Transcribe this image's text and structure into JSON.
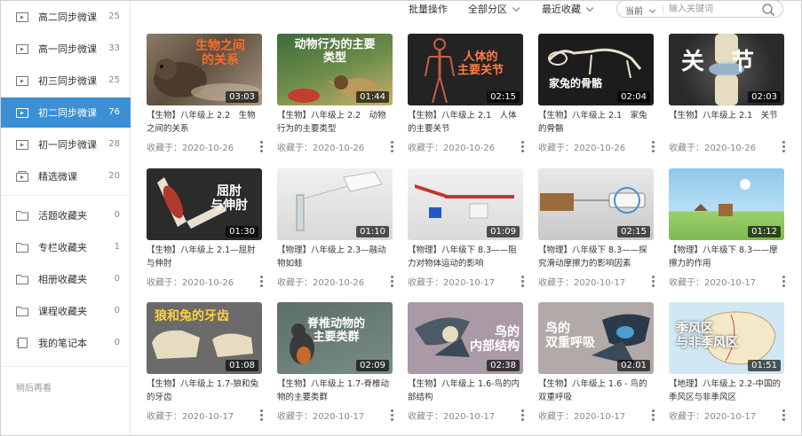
{
  "sidebar": {
    "items": [
      {
        "label": "高二同步微课",
        "count": "25",
        "icon": "video-folder-icon"
      },
      {
        "label": "高一同步微课",
        "count": "33",
        "icon": "video-folder-icon"
      },
      {
        "label": "初三同步微课",
        "count": "25",
        "icon": "video-folder-icon"
      },
      {
        "label": "初二同步微课",
        "count": "76",
        "icon": "video-folder-icon",
        "active": true
      },
      {
        "label": "初一同步微课",
        "count": "28",
        "icon": "video-folder-icon"
      },
      {
        "label": "精选微课",
        "count": "20",
        "icon": "featured-folder-icon"
      },
      {
        "label": "活题收藏夹",
        "count": "0",
        "icon": "folder-icon"
      },
      {
        "label": "专栏收藏夹",
        "count": "1",
        "icon": "folder-icon"
      },
      {
        "label": "相册收藏夹",
        "count": "0",
        "icon": "folder-icon"
      },
      {
        "label": "课程收藏夹",
        "count": "0",
        "icon": "folder-icon"
      },
      {
        "label": "我的笔记本",
        "count": "0",
        "icon": "notebook-icon"
      }
    ],
    "later_label": "稍后再看"
  },
  "toolbar": {
    "batch_label": "批量操作",
    "category_label": "全部分区",
    "sort_label": "最近收藏",
    "search_scope": "当前",
    "search_placeholder": "输入关键词"
  },
  "colors": {
    "accent": "#3c8fd4"
  },
  "cards": [
    {
      "thumb_text": "生物之间\n的关系",
      "duration": "03:03",
      "title": "【生物】八年级上 2.2　生物之间的关系",
      "meta": "收藏于：2020-10-26"
    },
    {
      "thumb_text": "动物行为的主要\n类型",
      "duration": "01:44",
      "title": "【生物】八年级上 2.2　动物行为的主要类型",
      "meta": "收藏于：2020-10-26"
    },
    {
      "thumb_text": "人体的\n主要关节",
      "duration": "02:15",
      "title": "【生物】八年级上 2.1　人体的主要关节",
      "meta": "收藏于：2020-10-26"
    },
    {
      "thumb_text": "家兔的骨骼",
      "duration": "02:04",
      "title": "【生物】八年级上 2.1　家兔的骨骼",
      "meta": "收藏于：2020-10-26"
    },
    {
      "thumb_text": "关　节",
      "duration": "02:03",
      "title": "【生物】八年级上 2.1　关节",
      "meta": "收藏于：2020-10-26"
    },
    {
      "thumb_text": "屈肘\n与伸肘",
      "duration": "01:30",
      "title": "【生物】八年级上 2.1—屈肘与伸肘",
      "meta": "收藏于：2020-10-26"
    },
    {
      "thumb_text": "",
      "duration": "01:10",
      "title": "【物理】八年级上 2.3—融动物如蛙",
      "meta": "收藏于：2020-10-26"
    },
    {
      "thumb_text": "",
      "duration": "01:09",
      "title": "【物理】八年级下 8.3——阻力对物体运动的影响",
      "meta": "收藏于：2020-10-17"
    },
    {
      "thumb_text": "",
      "duration": "02:15",
      "title": "【物理】八年级下 8.3——探究滑动摩擦力的影响因素",
      "meta": "收藏于：2020-10-17"
    },
    {
      "thumb_text": "",
      "duration": "01:12",
      "title": "【物理】八年级下 8.3——摩擦力的作用",
      "meta": "收藏于：2020-10-17"
    },
    {
      "thumb_text": "狼和兔的牙齿",
      "duration": "01:08",
      "title": "【生物】八年级上 1.7-狼和兔的牙齿",
      "meta": "收藏于：2020-10-17"
    },
    {
      "thumb_text": "脊椎动物的\n主要类群",
      "duration": "02:09",
      "title": "【生物】八年级上 1.7-脊椎动物的主要类群",
      "meta": "收藏于：2020-10-17"
    },
    {
      "thumb_text": "鸟的\n内部结构",
      "duration": "02:38",
      "title": "【生物】八年级上 1.6-鸟的内部结构",
      "meta": "收藏于：2020-10-17"
    },
    {
      "thumb_text": "鸟的\n双重呼吸",
      "duration": "02:01",
      "title": "【生物】八年级上 1.6 - 鸟的双重呼吸",
      "meta": "收藏于：2020-10-17"
    },
    {
      "thumb_text": "季风区\n与非季风区",
      "duration": "01:51",
      "title": "【地理】八年级上 2.2-中国的季风区与非季风区",
      "meta": "收藏于：2020-10-17"
    }
  ]
}
